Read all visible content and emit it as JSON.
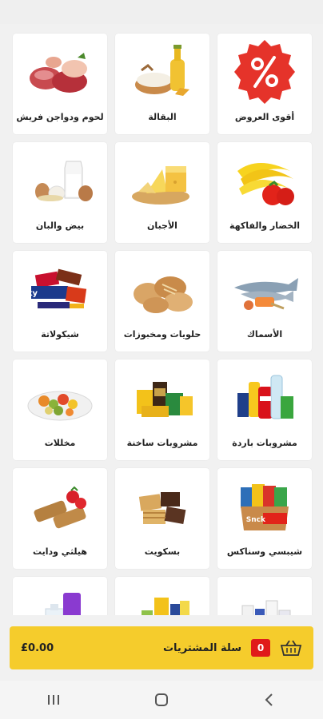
{
  "categories": [
    {
      "label": "أقوى العروض",
      "icon": "offers-percent-icon"
    },
    {
      "label": "البقالة",
      "icon": "grocery-oil-flour-icon"
    },
    {
      "label": "لحوم ودواجن فريش",
      "icon": "fresh-meat-icon"
    },
    {
      "label": "الخضار والفاكهة",
      "icon": "fruits-vegetables-icon"
    },
    {
      "label": "الأجبان",
      "icon": "cheese-icon"
    },
    {
      "label": "بيض والبان",
      "icon": "eggs-milk-icon"
    },
    {
      "label": "الأسماك",
      "icon": "fish-icon"
    },
    {
      "label": "حلويات ومخبوزات",
      "icon": "bakery-icon"
    },
    {
      "label": "شيكولاتة",
      "icon": "chocolate-icon"
    },
    {
      "label": "مشروبات باردة",
      "icon": "cold-drinks-icon"
    },
    {
      "label": "مشروبات ساخنة",
      "icon": "hot-drinks-icon"
    },
    {
      "label": "مخللات",
      "icon": "pickles-icon"
    },
    {
      "label": "شيبسي وسناكس",
      "icon": "chips-snacks-icon"
    },
    {
      "label": "بسكويت",
      "icon": "biscuits-icon"
    },
    {
      "label": "هيلثي ودايت",
      "icon": "healthy-diet-icon"
    },
    {
      "label": "",
      "icon": "personal-care-icon"
    },
    {
      "label": "",
      "icon": "household-cleaning-icon"
    },
    {
      "label": "",
      "icon": "cleaning-supplies-icon"
    }
  ],
  "cart": {
    "title": "سلة المشتريات",
    "count": "0",
    "total": "£0.00",
    "icon": "basket-icon"
  },
  "colors": {
    "accent": "#f5cc2c",
    "badge": "#e01a1a",
    "offer_red": "#e5332a"
  },
  "nav": {
    "recents": "recents-icon",
    "home": "home-icon",
    "back": "back-icon"
  }
}
